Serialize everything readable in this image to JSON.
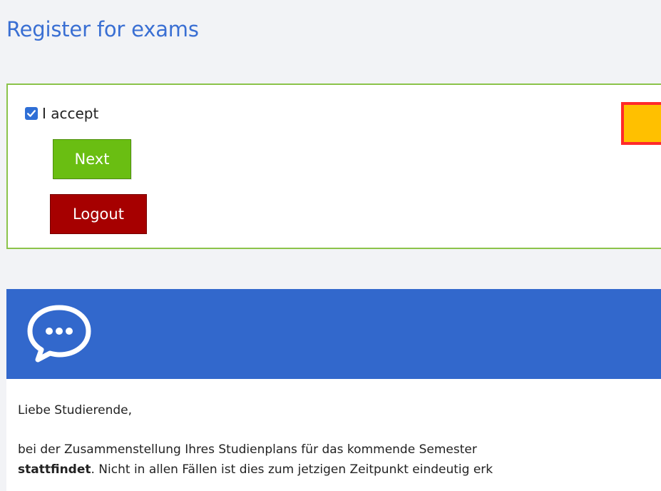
{
  "page": {
    "title": "Register for exams"
  },
  "accept_panel": {
    "checkbox_label": "I accept",
    "checkbox_checked": true,
    "next_label": "Next",
    "logout_label": "Logout"
  },
  "message": {
    "icon": "chat-bubble-icon",
    "greeting": "Liebe Studierende,",
    "line1": "bei der Zusammenstellung Ihres Studienplans für das kommende Semester",
    "line2_bold": "stattfindet",
    "line2_rest": ". Nicht in allen Fällen ist dies zum jetzigen Zeitpunkt eindeutig erk"
  },
  "colors": {
    "title_blue": "#3a6fd3",
    "panel_border": "#8bc34a",
    "next_green": "#6abe12",
    "logout_red": "#a60000",
    "header_blue": "#3268cc",
    "marker_fill": "#ffc000",
    "marker_border": "#ff2a2a"
  }
}
